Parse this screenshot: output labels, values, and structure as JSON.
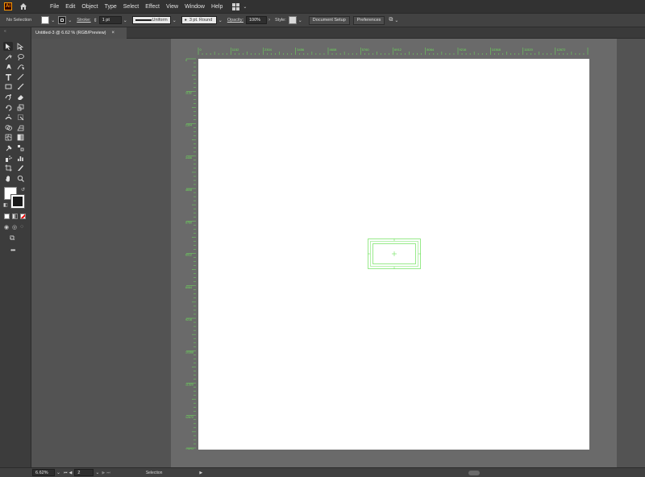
{
  "app": {
    "logo": "Ai"
  },
  "menu": {
    "items": [
      "File",
      "Edit",
      "Object",
      "Type",
      "Select",
      "Effect",
      "View",
      "Window",
      "Help"
    ]
  },
  "control_bar": {
    "selection": "No Selection",
    "stroke_label": "Stroke:",
    "stroke_value": "1 pt",
    "profile": "Uniform",
    "brush": "3 pt. Round",
    "opacity_label": "Opacity:",
    "opacity_value": "100%",
    "style_label": "Style:",
    "document_setup": "Document Setup",
    "preferences": "Preferences"
  },
  "document_tab": {
    "title": "Untitled-3 @ 6.62 % (RGB/Preview)",
    "close": "×"
  },
  "rulers": {
    "top": [
      "0",
      "1152",
      "2304",
      "3456",
      "4608",
      "5760",
      "6912",
      "8064",
      "9216",
      "10368",
      "11520",
      "12672",
      "13824"
    ],
    "left": [
      "0",
      "1152",
      "2304",
      "3456",
      "4608",
      "5760",
      "6912",
      "8064",
      "9216",
      "10368",
      "11520",
      "12672",
      "13824"
    ]
  },
  "status_bar": {
    "zoom": "6.62%",
    "artboard": "2",
    "tool": "Selection"
  },
  "colors": {
    "ruler": "#6de25a",
    "artboard": "#ffffff",
    "pasteboard": "#6a6a6a"
  },
  "tools": [
    "selection-tool",
    "direct-selection-tool",
    "magic-wand-tool",
    "lasso-tool",
    "pen-tool",
    "curvature-tool",
    "type-tool",
    "line-tool",
    "rectangle-tool",
    "paintbrush-tool",
    "shaper-tool",
    "eraser-tool",
    "rotate-tool",
    "scale-tool",
    "width-tool",
    "free-transform-tool",
    "shape-builder-tool",
    "perspective-grid-tool",
    "mesh-tool",
    "gradient-tool",
    "eyedropper-tool",
    "blend-tool",
    "symbol-sprayer-tool",
    "column-graph-tool",
    "artboard-tool",
    "slice-tool",
    "hand-tool",
    "zoom-tool"
  ]
}
